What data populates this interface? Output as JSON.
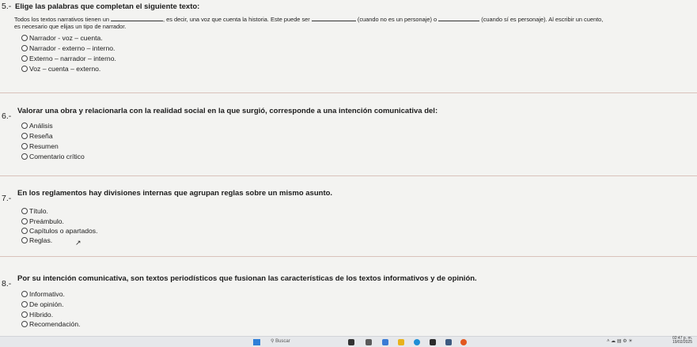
{
  "q5": {
    "number": "5.-",
    "title": "Elige las palabras que completan el siguiente texto:",
    "text_a": "Todos los textos narrativos tienen un",
    "text_b": ", es decir, una voz que cuenta la historia. Este puede ser",
    "text_c": "(cuando no es un personaje) o",
    "text_d": "(cuando sí es personaje). Al escribir un cuento,",
    "text_e": "es necesario que elijas un tipo de narrador.",
    "options": [
      "Narrador - voz – cuenta.",
      "Narrador - externo – interno.",
      "Externo – narrador – interno.",
      "Voz – cuenta – externo."
    ]
  },
  "q6": {
    "number": "6.-",
    "title": "Valorar una obra y relacionarla con la realidad social en la que surgió, corresponde a una intención comunicativa del:",
    "options": [
      "Análisis",
      "Reseña",
      "Resumen",
      "Comentario crítico"
    ]
  },
  "q7": {
    "number": "7.-",
    "title": "En los reglamentos hay divisiones internas que agrupan reglas sobre un mismo asunto.",
    "options": [
      "Título.",
      "Preámbulo.",
      "Capítulos o apartados.",
      "Reglas."
    ]
  },
  "q8": {
    "number": "8.-",
    "title": "Por su intención comunicativa, son textos periodísticos que fusionan las características de los textos informativos y de opinión.",
    "options": [
      "Informativo.",
      "De opinión.",
      "Híbrido.",
      "Recomendación."
    ]
  },
  "taskbar": {
    "search_label": "Buscar",
    "time": "02:47 p. m.",
    "date": "19/02/2025"
  },
  "colors": {
    "page_bg": "#f3f3f1",
    "separator": "#d9c2bb",
    "taskbar_bg": "#e6e8eb"
  }
}
